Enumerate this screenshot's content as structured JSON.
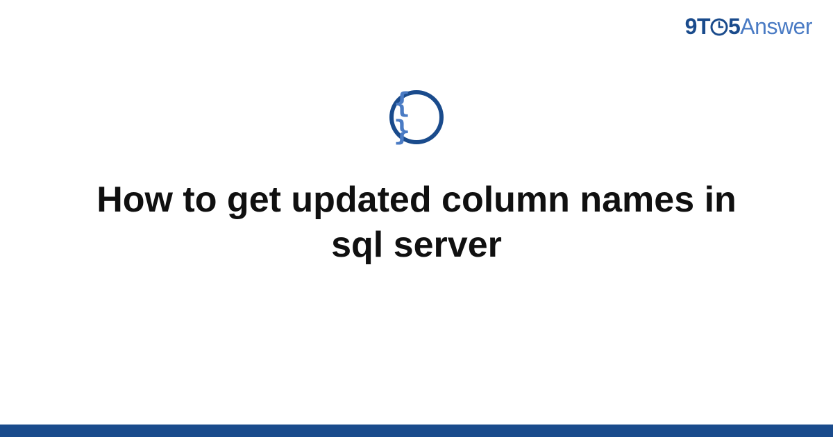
{
  "brand": {
    "prefix": "9T",
    "middle": "5",
    "suffix": "Answer"
  },
  "icon": {
    "braces": "{ }"
  },
  "title": "How to get updated column names in sql server",
  "colors": {
    "primary": "#1a4b8c",
    "accent": "#4a7bc4"
  }
}
